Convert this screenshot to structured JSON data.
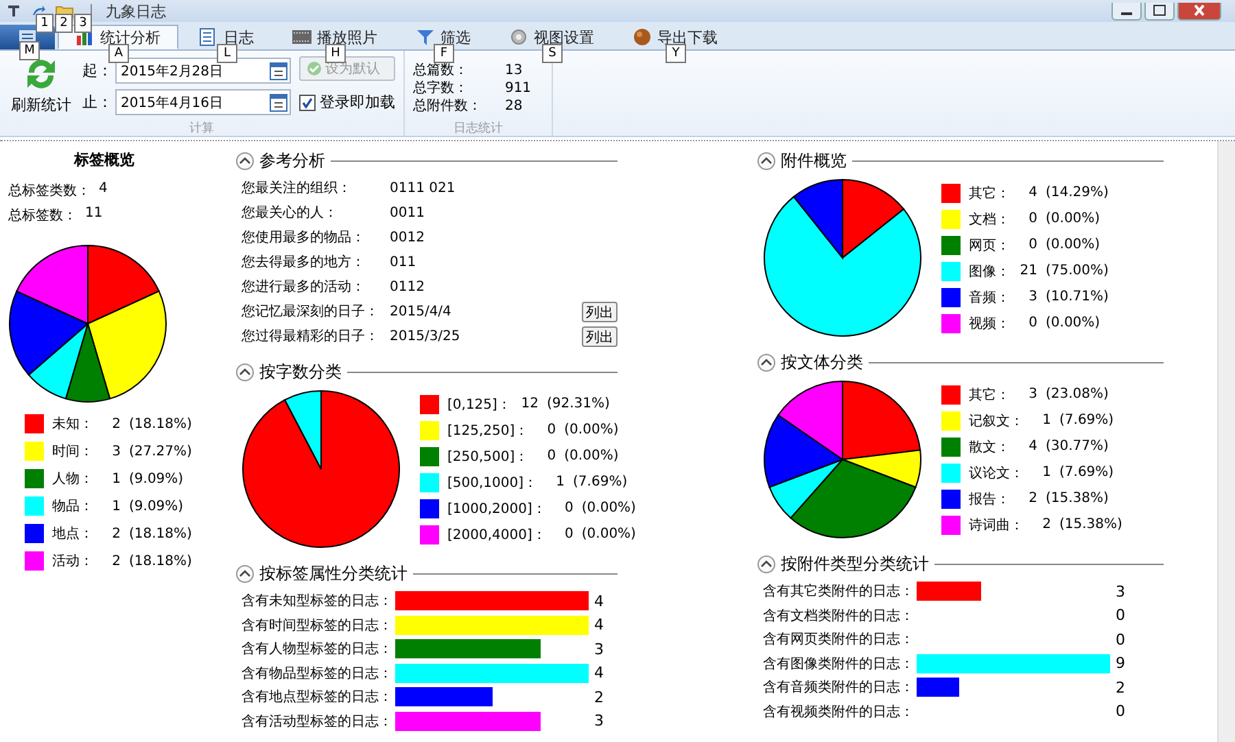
{
  "window": {
    "title": "九象日志"
  },
  "quick_access_keytips": [
    "1",
    "2",
    "3"
  ],
  "app_button": {
    "keytip": "M"
  },
  "tabs": [
    {
      "label": "统计分析",
      "keytip": "A",
      "selected": true
    },
    {
      "label": "日志",
      "keytip": "L",
      "selected": false
    },
    {
      "label": "播放照片",
      "keytip": "H",
      "selected": false
    },
    {
      "label": "筛选",
      "keytip": "F",
      "selected": false
    },
    {
      "label": "视图设置",
      "keytip": "S",
      "selected": false
    },
    {
      "label": "导出下载",
      "keytip": "Y",
      "selected": false
    }
  ],
  "ribbon": {
    "refresh_button": {
      "label": "刷新统计"
    },
    "date_from": {
      "label": "起：",
      "value": "2015年2月28日"
    },
    "date_to": {
      "label": "止：",
      "value": "2015年4月16日"
    },
    "default_button": {
      "label": "设为默认",
      "disabled": true
    },
    "checkbox": {
      "label": "登录即加载",
      "checked": true
    },
    "group_label": "计算",
    "stats": [
      {
        "label": "总篇数：",
        "value": "13"
      },
      {
        "label": "总字数：",
        "value": "911"
      },
      {
        "label": "总附件数：",
        "value": "28"
      }
    ],
    "stats_group_label": "日志统计"
  },
  "tag_overview": {
    "title": "标签概览",
    "stats": [
      {
        "label": "总标签类数：",
        "value": "4"
      },
      {
        "label": "总标签数：",
        "value": "11"
      }
    ],
    "chart_data": {
      "type": "pie",
      "values": [
        18.18,
        27.27,
        9.09,
        9.09,
        18.18,
        18.18
      ]
    },
    "legend": [
      {
        "label": "未知：",
        "count": "2",
        "percent": "(18.18%)",
        "color": "#ff0000"
      },
      {
        "label": "时间：",
        "count": "3",
        "percent": "(27.27%)",
        "color": "#ffff00"
      },
      {
        "label": "人物：",
        "count": "1",
        "percent": "(9.09%)",
        "color": "#008000"
      },
      {
        "label": "物品：",
        "count": "1",
        "percent": "(9.09%)",
        "color": "#00ffff"
      },
      {
        "label": "地点：",
        "count": "2",
        "percent": "(18.18%)",
        "color": "#0000ff"
      },
      {
        "label": "活动：",
        "count": "2",
        "percent": "(18.18%)",
        "color": "#ff00ff"
      }
    ]
  },
  "reference_analysis": {
    "title": "参考分析",
    "rows": [
      {
        "label": "您最关注的组织：",
        "value": "0111 021"
      },
      {
        "label": "您最关心的人：",
        "value": "0011"
      },
      {
        "label": "您使用最多的物品：",
        "value": "0012"
      },
      {
        "label": "您去得最多的地方：",
        "value": "011"
      },
      {
        "label": "您进行最多的活动：",
        "value": "0112"
      },
      {
        "label": "您记忆最深刻的日子：",
        "value": "2015/4/4",
        "button": "列出"
      },
      {
        "label": "您过得最精彩的日子：",
        "value": "2015/3/25",
        "button": "列出"
      }
    ]
  },
  "word_count": {
    "title": "按字数分类",
    "chart_data": {
      "type": "pie",
      "values": [
        92.31,
        0,
        0,
        7.69,
        0,
        0
      ]
    },
    "legend": [
      {
        "label": "[0,125]：",
        "count": "12",
        "percent": "(92.31%)",
        "color": "#ff0000"
      },
      {
        "label": "[125,250]：",
        "count": "0",
        "percent": "(0.00%)",
        "color": "#ffff00"
      },
      {
        "label": "[250,500]：",
        "count": "0",
        "percent": "(0.00%)",
        "color": "#008000"
      },
      {
        "label": "[500,1000]：",
        "count": "1",
        "percent": "(7.69%)",
        "color": "#00ffff"
      },
      {
        "label": "[1000,2000]：",
        "count": "0",
        "percent": "(0.00%)",
        "color": "#0000ff"
      },
      {
        "label": "[2000,4000]：",
        "count": "0",
        "percent": "(0.00%)",
        "color": "#ff00ff"
      }
    ]
  },
  "tag_attribute_stats": {
    "title": "按标签属性分类统计",
    "label_separator": "：",
    "chart_data": {
      "type": "bar",
      "orientation": "horizontal",
      "data_labels": true,
      "categories": [
        "含有未知型标签的日志",
        "含有时间型标签的日志",
        "含有人物型标签的日志",
        "含有物品型标签的日志",
        "含有地点型标签的日志",
        "含有活动型标签的日志"
      ],
      "values": [
        4,
        4,
        3,
        4,
        2,
        3
      ],
      "colors": [
        "#ff0000",
        "#ffff00",
        "#008000",
        "#00ffff",
        "#0000ff",
        "#ff00ff"
      ]
    }
  },
  "attachment_overview": {
    "title": "附件概览",
    "chart_data": {
      "type": "pie",
      "values": [
        14.29,
        0,
        0,
        75,
        10.71,
        0
      ]
    },
    "legend": [
      {
        "label": "其它：",
        "count": "4",
        "percent": "(14.29%)",
        "color": "#ff0000"
      },
      {
        "label": "文档：",
        "count": "0",
        "percent": "(0.00%)",
        "color": "#ffff00"
      },
      {
        "label": "网页：",
        "count": "0",
        "percent": "(0.00%)",
        "color": "#008000"
      },
      {
        "label": "图像：",
        "count": "21",
        "percent": "(75.00%)",
        "color": "#00ffff"
      },
      {
        "label": "音频：",
        "count": "3",
        "percent": "(10.71%)",
        "color": "#0000ff"
      },
      {
        "label": "视频：",
        "count": "0",
        "percent": "(0.00%)",
        "color": "#ff00ff"
      }
    ]
  },
  "genre": {
    "title": "按文体分类",
    "chart_data": {
      "type": "pie",
      "values": [
        23.08,
        7.69,
        30.77,
        7.69,
        15.38,
        15.38
      ]
    },
    "legend": [
      {
        "label": "其它：",
        "count": "3",
        "percent": "(23.08%)",
        "color": "#ff0000"
      },
      {
        "label": "记叙文：",
        "count": "1",
        "percent": "(7.69%)",
        "color": "#ffff00"
      },
      {
        "label": "散文：",
        "count": "4",
        "percent": "(30.77%)",
        "color": "#008000"
      },
      {
        "label": "议论文：",
        "count": "1",
        "percent": "(7.69%)",
        "color": "#00ffff"
      },
      {
        "label": "报告：",
        "count": "2",
        "percent": "(15.38%)",
        "color": "#0000ff"
      },
      {
        "label": "诗词曲：",
        "count": "2",
        "percent": "(15.38%)",
        "color": "#ff00ff"
      }
    ]
  },
  "attachment_type_stats": {
    "title": "按附件类型分类统计",
    "label_separator": "：",
    "chart_data": {
      "type": "bar",
      "orientation": "horizontal",
      "data_labels": true,
      "categories": [
        "含有其它类附件的日志",
        "含有文档类附件的日志",
        "含有网页类附件的日志",
        "含有图像类附件的日志",
        "含有音频类附件的日志",
        "含有视频类附件的日志"
      ],
      "values": [
        3,
        0,
        0,
        9,
        2,
        0
      ],
      "colors": [
        "#ff0000",
        null,
        null,
        "#00ffff",
        "#0000ff",
        null
      ]
    }
  }
}
